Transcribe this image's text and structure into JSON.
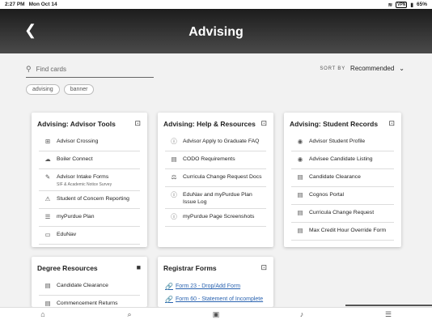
{
  "status": {
    "time": "2:27 PM",
    "date": "Mon Oct 14",
    "vpn": "VPN",
    "battery": "65%"
  },
  "header": {
    "title": "Advising",
    "back": "❮"
  },
  "search": {
    "placeholder": "Find cards"
  },
  "sort": {
    "label": "SORT BY",
    "value": "Recommended"
  },
  "chips": [
    "advising",
    "banner"
  ],
  "cards": [
    {
      "title": "Advising: Advisor Tools",
      "items": [
        {
          "icon": "⊞",
          "label": "Advisor Crossing",
          "sub": ""
        },
        {
          "icon": "☁",
          "label": "Boiler Connect",
          "sub": ""
        },
        {
          "icon": "✎",
          "label": "Advisor Intake Forms",
          "sub": "SIF & Academic Notice Survey"
        },
        {
          "icon": "⚠",
          "label": "Student of Concern Reporting",
          "sub": ""
        },
        {
          "icon": "☰",
          "label": "myPurdue Plan",
          "sub": ""
        },
        {
          "icon": "▭",
          "label": "EduNav",
          "sub": ""
        }
      ]
    },
    {
      "title": "Advising: Help & Resources",
      "items": [
        {
          "icon": "ⓘ",
          "label": "Advisor Apply to Graduate FAQ",
          "sub": ""
        },
        {
          "icon": "▤",
          "label": "CODO Requirements",
          "sub": ""
        },
        {
          "icon": "⚖",
          "label": "Curricula Change Request Docs",
          "sub": ""
        },
        {
          "icon": "ⓘ",
          "label": "EduNav and myPurdue Plan Issue Log",
          "sub": ""
        },
        {
          "icon": "ⓘ",
          "label": "myPurdue Page Screenshots",
          "sub": ""
        }
      ]
    },
    {
      "title": "Advising: Student Records",
      "items": [
        {
          "icon": "◉",
          "label": "Advisor Student Profile",
          "sub": ""
        },
        {
          "icon": "◉",
          "label": "Advisee Candidate Listing",
          "sub": ""
        },
        {
          "icon": "▤",
          "label": "Candidate Clearance",
          "sub": ""
        },
        {
          "icon": "▤",
          "label": "Cognos Portal",
          "sub": ""
        },
        {
          "icon": "▤",
          "label": "Curricula Change Request",
          "sub": ""
        },
        {
          "icon": "▤",
          "label": "Max Credit Hour Override Form",
          "sub": ""
        }
      ]
    },
    {
      "title": "Degree Resources",
      "items": [
        {
          "icon": "▤",
          "label": "Candidate Clearance",
          "sub": ""
        },
        {
          "icon": "▤",
          "label": "Commencement Returns",
          "sub": ""
        }
      ]
    },
    {
      "title": "Registrar Forms",
      "links": [
        {
          "icon": "🔗",
          "label": "Form 23 - Drop/Add Form"
        },
        {
          "icon": "🔗",
          "label": "Form 60 - Statement of Incomplete"
        }
      ]
    }
  ],
  "tabs": [
    {
      "name": "home-icon",
      "glyph": "⌂"
    },
    {
      "name": "search-icon",
      "glyph": "⌕"
    },
    {
      "name": "calendar-icon",
      "glyph": "▣"
    },
    {
      "name": "bell-icon",
      "glyph": "♪"
    },
    {
      "name": "menu-icon",
      "glyph": "☰"
    }
  ]
}
